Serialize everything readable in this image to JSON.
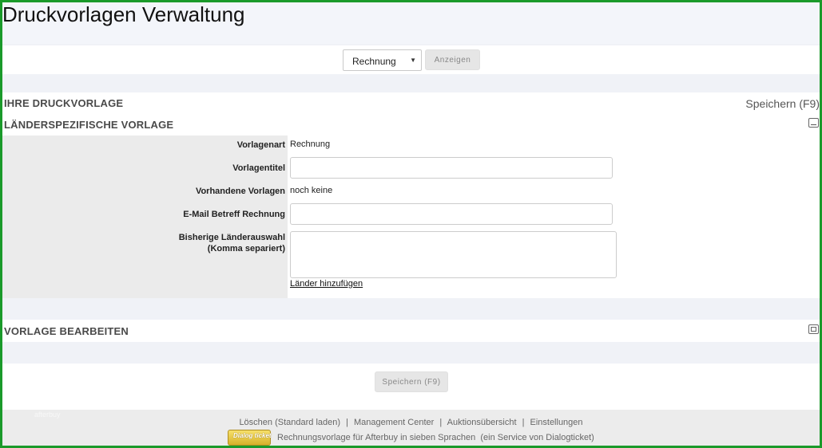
{
  "page": {
    "title": "Druckvorlagen Verwaltung"
  },
  "selector": {
    "selected": "Rechnung",
    "show_button": "Anzeigen"
  },
  "main_section": {
    "heading": "IHRE DRUCKVORLAGE",
    "save_link": "Speichern (F9)",
    "sub_heading": "LÄNDERSPEZIFISCHE VORLAGE",
    "fields": {
      "type_label": "Vorlagenart",
      "type_value": "Rechnung",
      "title_label": "Vorlagentitel",
      "title_value": "",
      "existing_label": "Vorhandene Vorlagen",
      "existing_value": "noch keine",
      "email_label": "E-Mail Betreff Rechnung",
      "email_value": "",
      "countries_label_line1": "Bisherige Länderauswahl",
      "countries_label_line2": "(Komma separiert)",
      "countries_value": "",
      "add_countries_link": "Länder hinzufügen"
    }
  },
  "edit_section": {
    "heading": "VORLAGE BEARBEITEN"
  },
  "save_bar": {
    "save_button": "Speichern (F9)"
  },
  "footer": {
    "ghost_text": "afterbuy",
    "links": [
      "Löschen (Standard laden)",
      "Management Center",
      "Auktionsübersicht",
      "Einstellungen"
    ],
    "logo_text": "Dialog ticket",
    "description": "Rechnungsvorlage für Afterbuy in sieben Sprachen  (ein Service von Dialogticket)"
  },
  "colors": {
    "frame_border": "#1a9a2a",
    "background": "#f0f2f7",
    "label_column": "#ebebeb",
    "button_bg": "#e6e6e6"
  },
  "icons": {
    "caret": "chevron-down-icon",
    "collapse": "collapse-icon",
    "expand": "expand-icon"
  }
}
